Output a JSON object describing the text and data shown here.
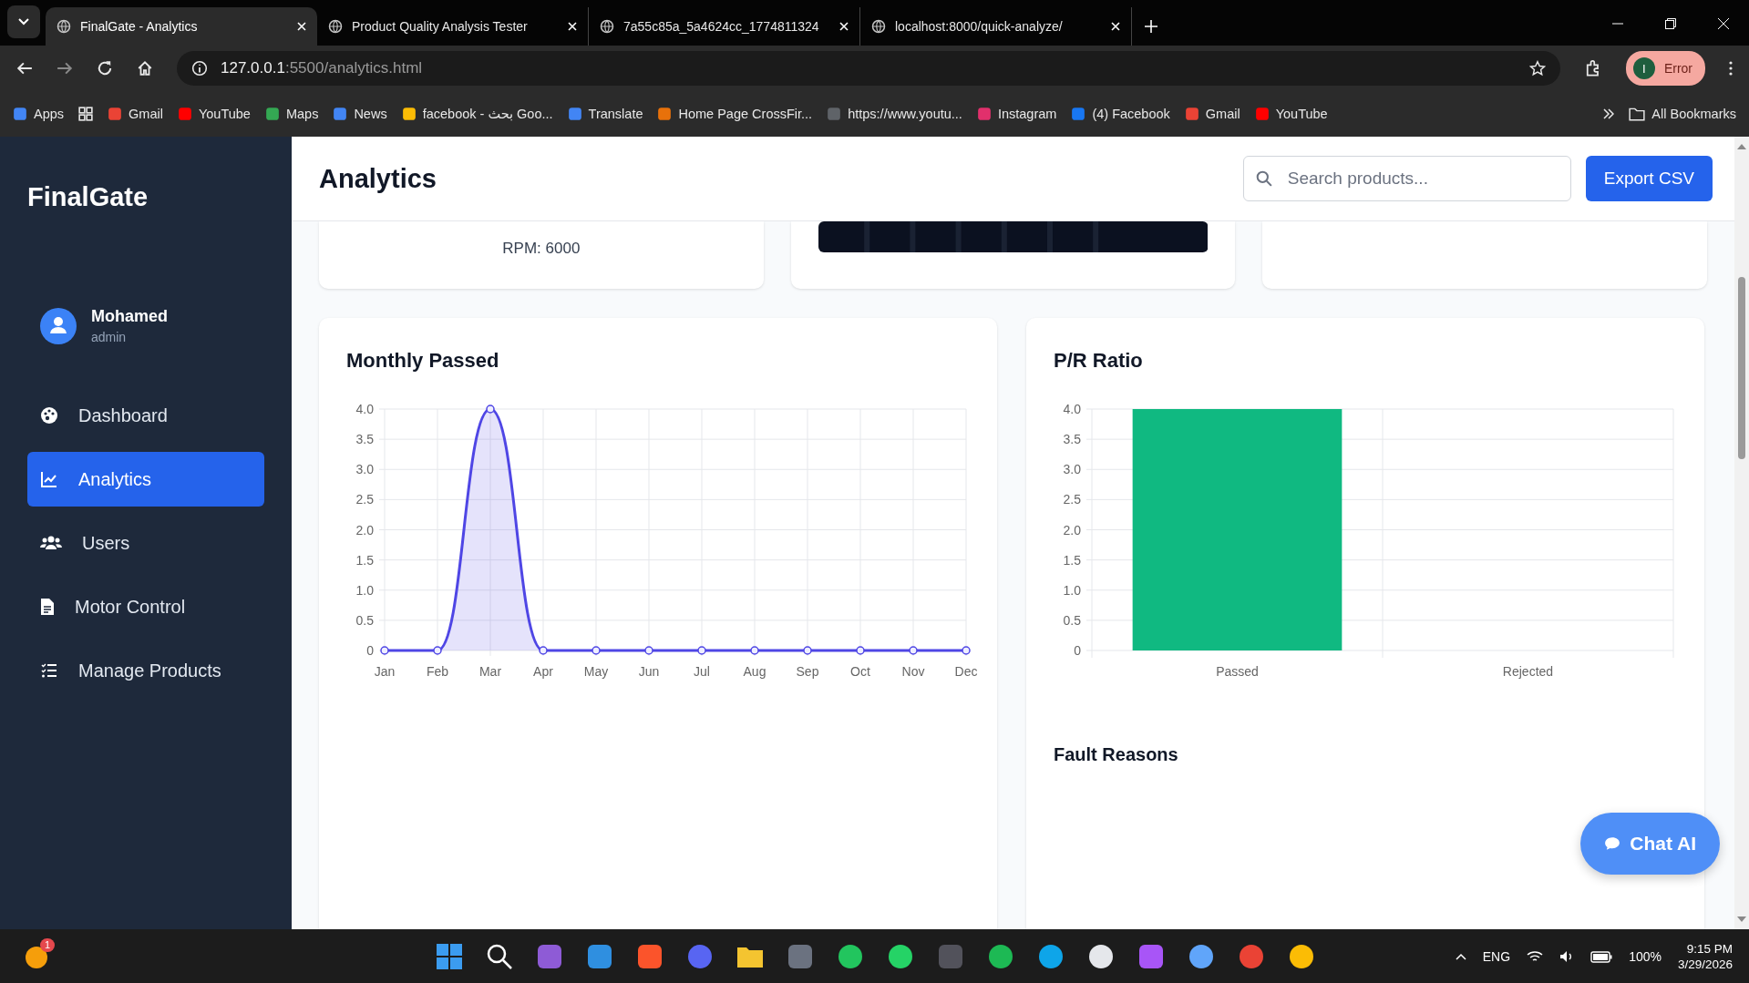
{
  "browser": {
    "tabs": [
      {
        "title": "FinalGate - Analytics",
        "selected": true
      },
      {
        "title": "Product Quality Analysis Tester",
        "selected": false
      },
      {
        "title": "7a55c85a_5a4624cc_1774811324",
        "selected": false
      },
      {
        "title": "localhost:8000/quick-analyze/",
        "selected": false
      }
    ],
    "address": {
      "host": "127.0.0.1",
      "path": ":5500/analytics.html"
    },
    "profile": {
      "initial": "I",
      "label": "Error"
    },
    "bookmarks": [
      {
        "label": "Apps",
        "color": "#4285f4"
      },
      {
        "label": "Gmail",
        "color": "#ea4335"
      },
      {
        "label": "YouTube",
        "color": "#ff0000"
      },
      {
        "label": "Maps",
        "color": "#34a853"
      },
      {
        "label": "News",
        "color": "#4285f4"
      },
      {
        "label": "facebook - بحث Goo...",
        "color": "#fbbc05"
      },
      {
        "label": "Translate",
        "color": "#4285f4"
      },
      {
        "label": "Home Page CrossFir...",
        "color": "#e8710a"
      },
      {
        "label": "https://www.youtu...",
        "color": "#5f6368"
      },
      {
        "label": "Instagram",
        "color": "#e1306c"
      },
      {
        "label": "(4) Facebook",
        "color": "#1877f2"
      },
      {
        "label": "Gmail",
        "color": "#ea4335"
      },
      {
        "label": "YouTube",
        "color": "#ff0000"
      }
    ],
    "all_bookmarks": "All Bookmarks"
  },
  "sidebar": {
    "logo": "FinalGate",
    "user": {
      "name": "Mohamed",
      "role": "admin"
    },
    "items": [
      {
        "label": "Dashboard",
        "selected": false
      },
      {
        "label": "Analytics",
        "selected": true
      },
      {
        "label": "Users",
        "selected": false
      },
      {
        "label": "Motor Control",
        "selected": false
      },
      {
        "label": "Manage Products",
        "selected": false
      }
    ]
  },
  "header": {
    "title": "Analytics",
    "search": {
      "placeholder": "Search products..."
    },
    "export_button": "Export CSV"
  },
  "top_cards": [
    {
      "kind": "reading",
      "text": "RPM: 6000"
    },
    {
      "kind": "picture"
    },
    {
      "kind": "empty"
    }
  ],
  "monthly_passed": {
    "title": "Monthly Passed",
    "chart_data": {
      "type": "area",
      "categories": [
        "Jan",
        "Feb",
        "Mar",
        "Apr",
        "May",
        "Jun",
        "Jul",
        "Aug",
        "Sep",
        "Oct",
        "Nov",
        "Dec"
      ],
      "series": [
        {
          "color": "#4f46e5",
          "values": [
            0,
            0,
            4,
            0,
            0,
            0,
            0,
            0,
            0,
            0,
            0,
            0
          ]
        }
      ],
      "grid": true,
      "ylim": [
        0,
        4
      ],
      "yticks": [
        0,
        0.5,
        {
          "value": 1,
          "label": "1.0"
        },
        1.5,
        {
          "value": 2,
          "label": "2.0"
        },
        2.5,
        {
          "value": 3,
          "label": "3.0"
        },
        3.5,
        {
          "value": 4,
          "label": "4.0"
        }
      ]
    }
  },
  "pr_ratio": {
    "title": "P/R Ratio",
    "chart_data": {
      "type": "bar",
      "categories": [
        "Passed",
        "Rejected"
      ],
      "series": [
        {
          "color": "#10b981",
          "values": [
            4,
            0
          ]
        }
      ],
      "grid": true,
      "ylim": [
        0,
        4
      ],
      "yticks": [
        0,
        0.5,
        {
          "value": 1,
          "label": "1.0"
        },
        1.5,
        {
          "value": 2,
          "label": "2.0"
        },
        2.5,
        {
          "value": 3,
          "label": "3.0"
        },
        3.5,
        {
          "value": 4,
          "label": "4.0"
        }
      ]
    },
    "fault_title": "Fault Reasons"
  },
  "chat_button": "Chat AI",
  "taskbar": {
    "notification_count": "1",
    "language": "ENG",
    "battery": "100%",
    "time": "9:15 PM",
    "date": "3/29/2026"
  }
}
